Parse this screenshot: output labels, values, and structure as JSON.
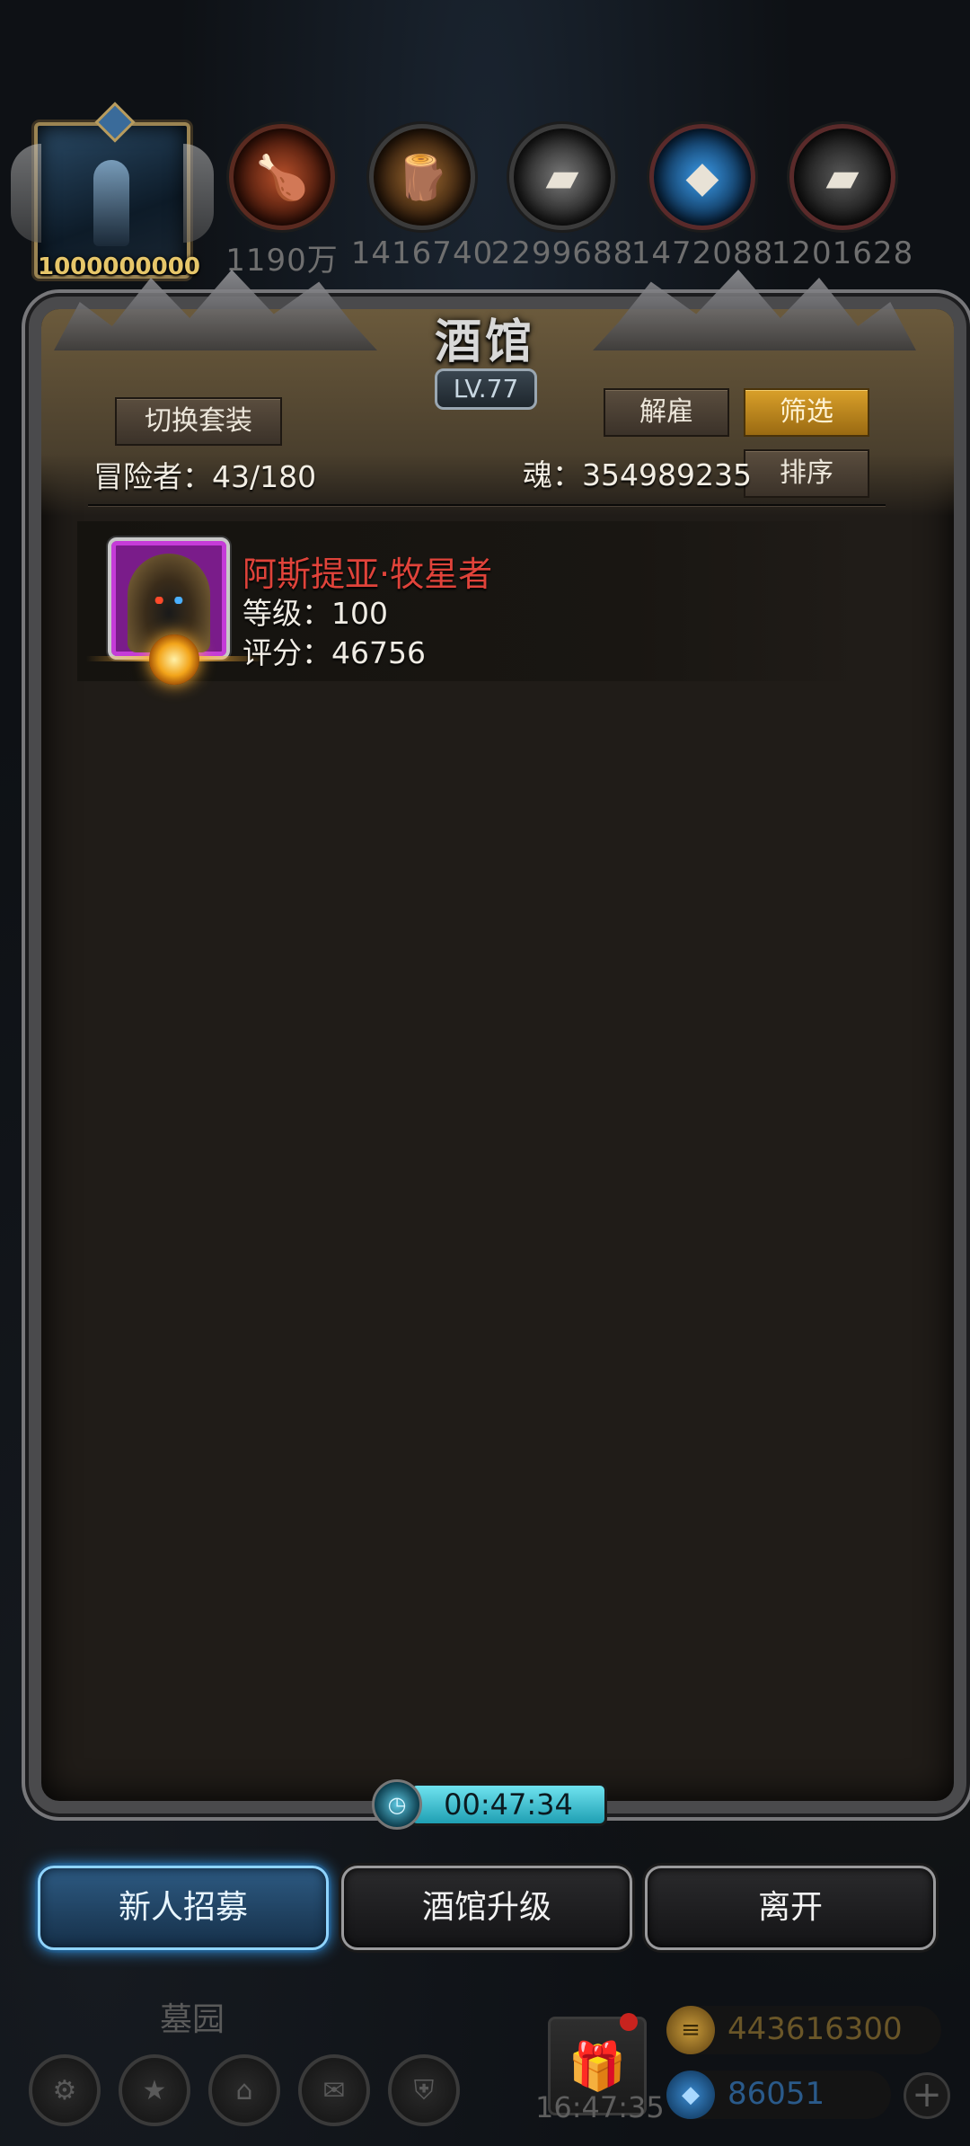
{
  "player": {
    "power": "1000000000"
  },
  "resources": [
    {
      "icon": "meat-icon",
      "value": "1190万",
      "color": "#8a3a20"
    },
    {
      "icon": "wood-icon",
      "value": "1416740",
      "color": "#8a5a2a"
    },
    {
      "icon": "iron-icon",
      "value": "2299688",
      "color": "#6a6a6a"
    },
    {
      "icon": "crystal-icon",
      "value": "1472088",
      "color": "#2a7ad0"
    },
    {
      "icon": "steel-icon",
      "value": "1201628",
      "color": "#555555"
    }
  ],
  "tavern": {
    "title": "酒馆",
    "level": "LV.77",
    "switch_outfit": "切换套装",
    "dismiss": "解雇",
    "filter": "筛选",
    "sort": "排序",
    "adventurers_label": "冒险者：43/180",
    "soul_label": "魂：354989235",
    "heroes": [
      {
        "name": "阿斯提亚·牧星者",
        "level": "等级：100",
        "score": "评分：46756"
      }
    ],
    "timer": "00:47:34"
  },
  "actions": {
    "recruit": "新人招募",
    "upgrade": "酒馆升级",
    "leave": "离开"
  },
  "bottom": {
    "location": "墓园",
    "clock": "16:47:35",
    "gold": "443616300",
    "gems": "86051"
  },
  "colors": {
    "accent_gold": "#d9a02a",
    "hero_name": "#e0433a",
    "timer": "#6fe3ef",
    "recruit_glow": "#3aa8ff"
  }
}
